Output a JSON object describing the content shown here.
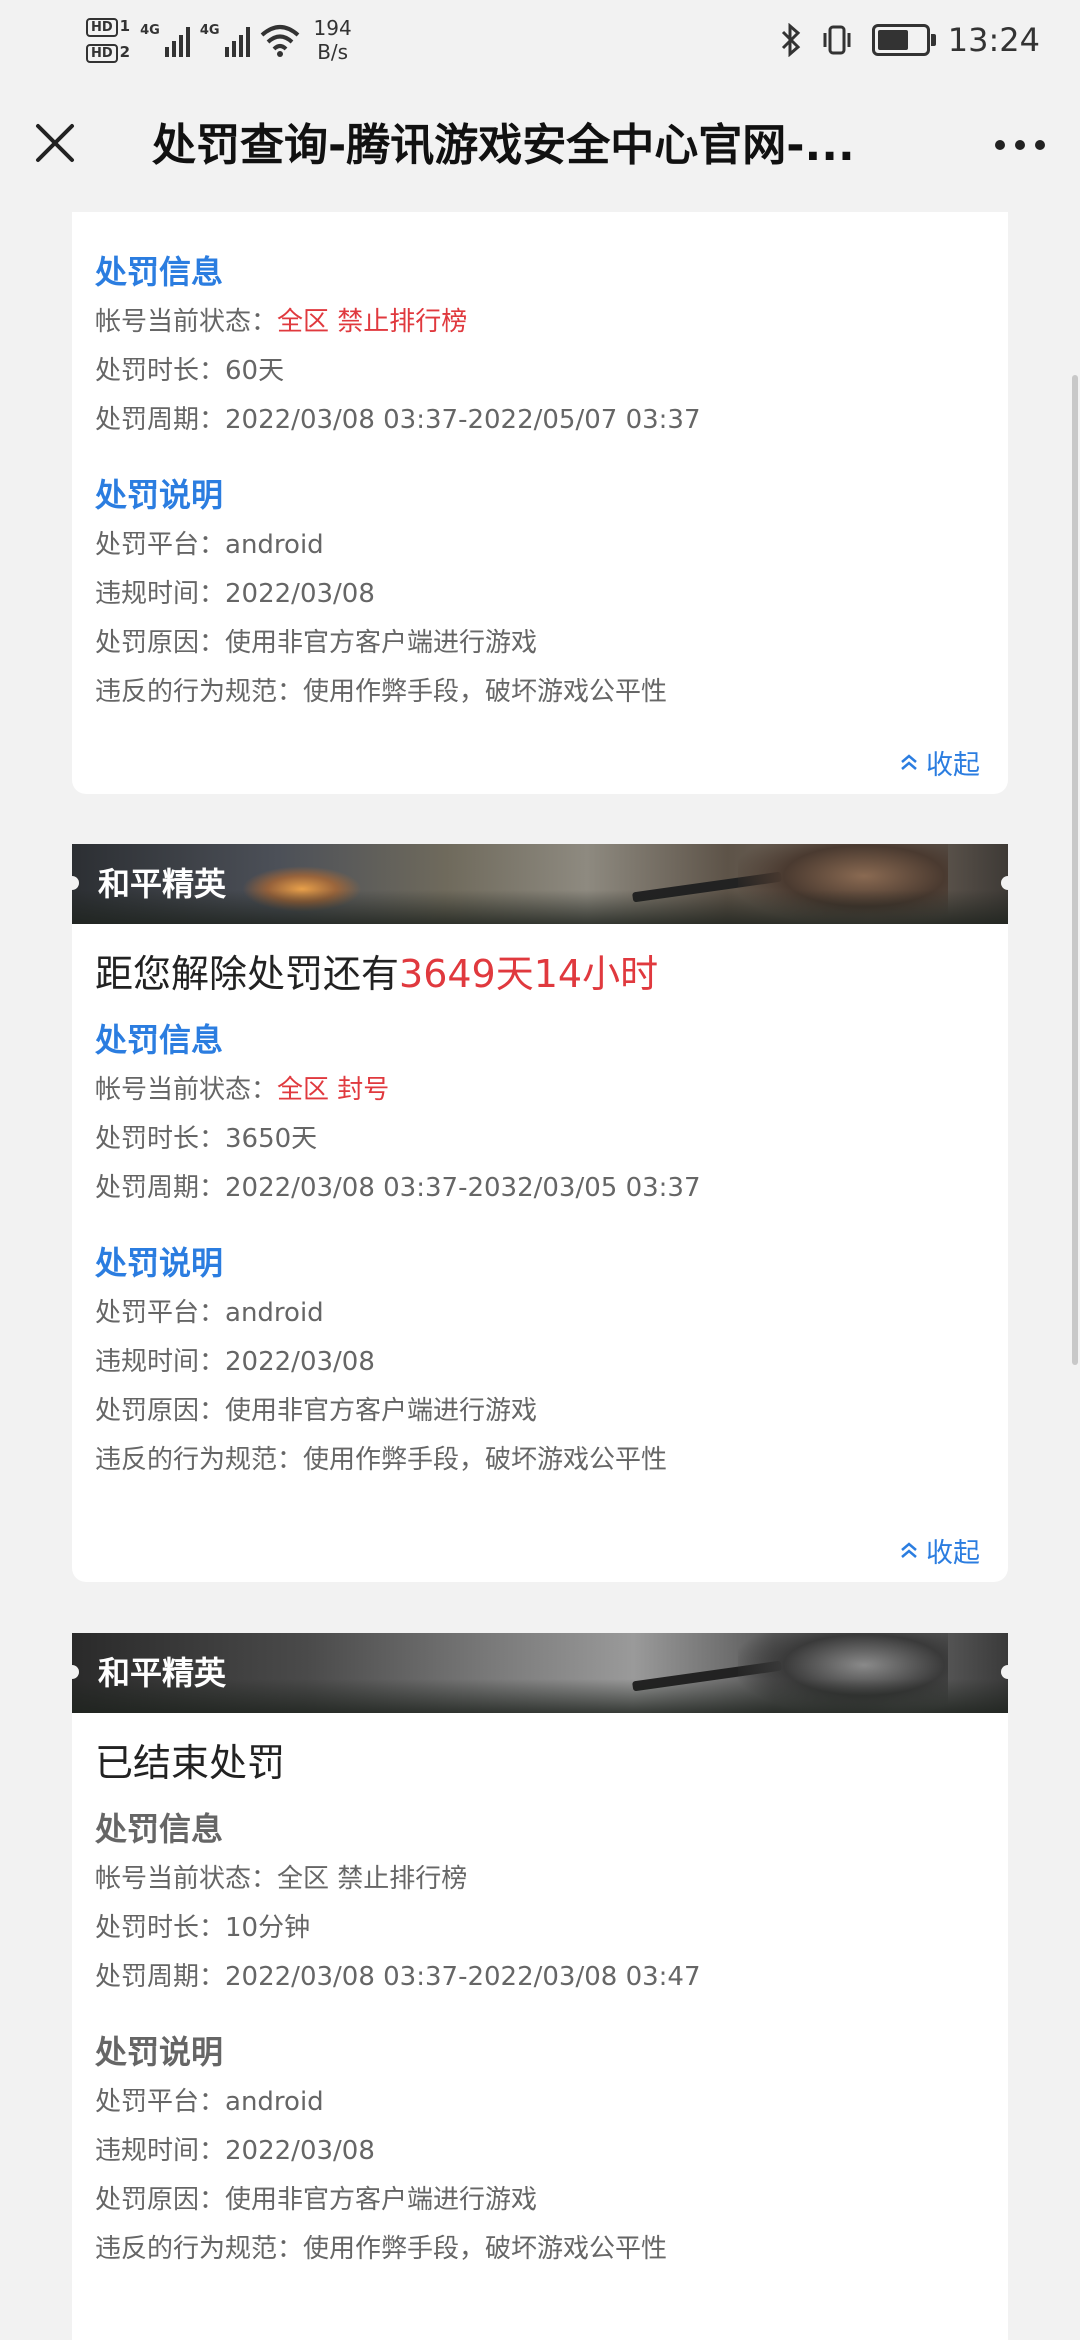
{
  "status_bar": {
    "sim1": "HD",
    "sim1_index": "1",
    "sim2": "HD",
    "sim2_index": "2",
    "net1": "4G",
    "net2": "4G",
    "speed_value": "194",
    "speed_unit": "B/s",
    "time": "13:24",
    "battery_level": 0.75
  },
  "titlebar": {
    "title": "处罚查询-腾讯游戏安全中心官网-..."
  },
  "labels": {
    "info_title": "处罚信息",
    "desc_title": "处罚说明",
    "status_label": "帐号当前状态：",
    "duration_label": "处罚时长：",
    "period_label": "处罚周期：",
    "platform_label": "处罚平台：",
    "violation_time_label": "违规时间：",
    "reason_label": "处罚原因：",
    "rule_label": "违反的行为规范：",
    "collapse": "收起"
  },
  "cards": [
    {
      "game": "",
      "countdown_prefix": "",
      "countdown_value": "",
      "status": "全区 禁止排行榜",
      "duration": "60天",
      "period": "2022/03/08 03:37-2022/05/07 03:37",
      "platform": "android",
      "violation_time": "2022/03/08",
      "reason": "使用非官方客户端进行游戏",
      "rule": "使用作弊手段，破坏游戏公平性"
    },
    {
      "game": "和平精英",
      "countdown_prefix": "距您解除处罚还有",
      "countdown_value": "3649天14小时",
      "status": "全区 封号",
      "duration": "3650天",
      "period": "2022/03/08 03:37-2032/03/05 03:37",
      "platform": "android",
      "violation_time": "2022/03/08",
      "reason": "使用非官方客户端进行游戏",
      "rule": "使用作弊手段，破坏游戏公平性"
    },
    {
      "game": "和平精英",
      "ended_text": "已结束处罚",
      "status": "全区 禁止排行榜",
      "duration": "10分钟",
      "period": "2022/03/08 03:37-2022/03/08 03:47",
      "platform": "android",
      "violation_time": "2022/03/08",
      "reason": "使用非官方客户端进行游戏",
      "rule": "使用作弊手段，破坏游戏公平性"
    }
  ],
  "colors": {
    "accent_blue": "#2b7de0",
    "alert_red": "#e0393e",
    "text_gray": "#666666",
    "background": "#f2f2f2"
  }
}
